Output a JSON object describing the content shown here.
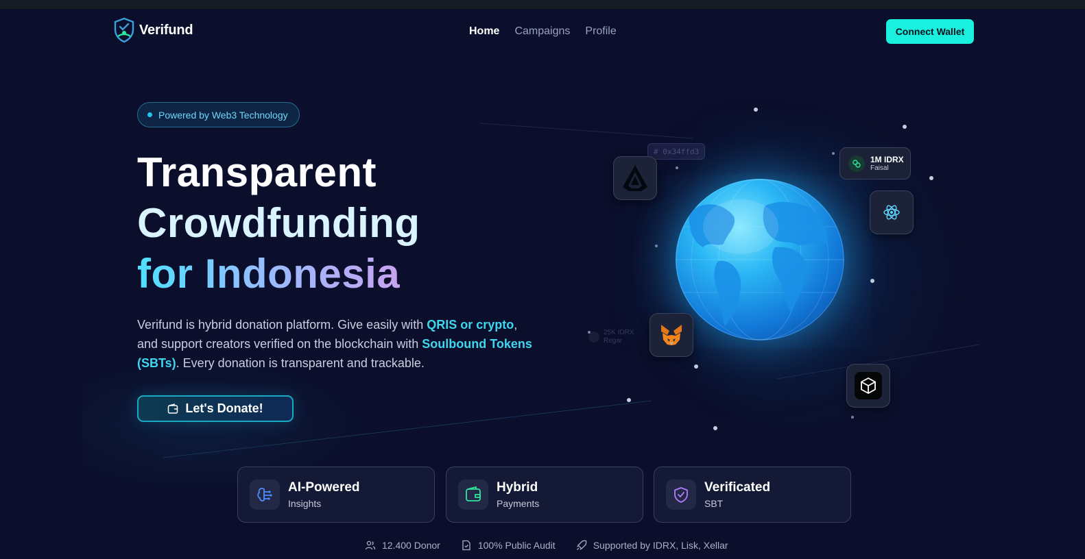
{
  "brand": {
    "name": "Verifund"
  },
  "nav": {
    "links": [
      {
        "label": "Home",
        "active": true
      },
      {
        "label": "Campaigns",
        "active": false
      },
      {
        "label": "Profile",
        "active": false
      }
    ],
    "connect_label": "Connect Wallet"
  },
  "hero": {
    "badge": "Powered by Web3 Technology",
    "title_line1": "Transparent",
    "title_line2": "Crowdfunding",
    "title_line3": "for Indonesia",
    "desc_part1": "Verifund is hybrid donation platform. Give easily with ",
    "desc_hl1": "QRIS or crypto",
    "desc_part2": ", and support creators verified on the blockchain with ",
    "desc_hl2": "Soulbound Tokens (SBTs)",
    "desc_part3": ". Every donation is transparent and trackable.",
    "cta_label": "Let's Donate!"
  },
  "visual": {
    "hash_tag": "# 0x34ffd3",
    "donation_amount": "1M IDRX",
    "donation_name": "Faisal",
    "ghost_amount": "25K IDRX",
    "ghost_name": "Regar",
    "tiles": [
      "lisk-icon",
      "react-icon",
      "metamask-icon",
      "cube-icon"
    ]
  },
  "features": [
    {
      "title": "AI-Powered",
      "subtitle": "Insights",
      "icon": "brain-icon",
      "color": "#4f8cff"
    },
    {
      "title": "Hybrid",
      "subtitle": "Payments",
      "icon": "wallet-icon",
      "color": "#2ee59d"
    },
    {
      "title": "Verificated",
      "subtitle": "SBT",
      "icon": "shield-check-icon",
      "color": "#b07cff"
    }
  ],
  "stats": [
    {
      "label": "12.400 Donor",
      "icon": "users-icon"
    },
    {
      "label": "100% Public Audit",
      "icon": "document-icon"
    },
    {
      "label": "Supported by IDRX, Lisk, Xellar",
      "icon": "rocket-icon"
    }
  ]
}
